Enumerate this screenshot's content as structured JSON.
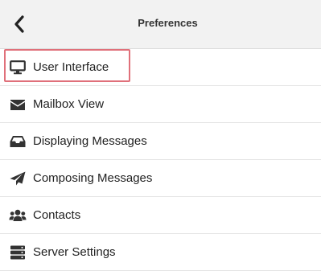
{
  "header": {
    "title": "Preferences",
    "back_icon": "chevron-left-icon"
  },
  "menu": {
    "items": [
      {
        "label": "User Interface",
        "icon": "monitor-icon"
      },
      {
        "label": "Mailbox View",
        "icon": "envelope-icon"
      },
      {
        "label": "Displaying Messages",
        "icon": "inbox-tray-icon"
      },
      {
        "label": "Composing Messages",
        "icon": "paper-plane-icon"
      },
      {
        "label": "Contacts",
        "icon": "users-icon"
      },
      {
        "label": "Server Settings",
        "icon": "server-icon"
      }
    ]
  },
  "colors": {
    "header_bg": "#f2f2f2",
    "highlight_border": "#e0707a",
    "icon": "#333333"
  }
}
